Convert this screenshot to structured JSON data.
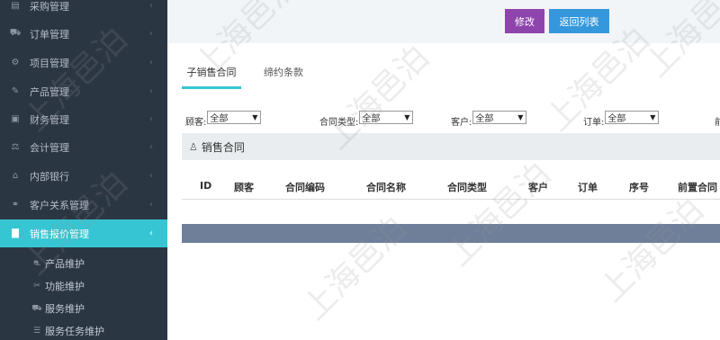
{
  "sidebar": {
    "items": [
      {
        "label": "采购管理",
        "icon": "cart-icon",
        "glyph": "▤"
      },
      {
        "label": "订单管理",
        "icon": "shopping-cart-icon",
        "glyph": "⛟"
      },
      {
        "label": "项目管理",
        "icon": "cogs-icon",
        "glyph": "⚙"
      },
      {
        "label": "产品管理",
        "icon": "edit-icon",
        "glyph": "✎"
      },
      {
        "label": "财务管理",
        "icon": "money-icon",
        "glyph": "▣"
      },
      {
        "label": "会计管理",
        "icon": "balance-scale-icon",
        "glyph": "⚖"
      },
      {
        "label": "内部银行",
        "icon": "bank-icon",
        "glyph": "⌂"
      },
      {
        "label": "客户关系管理",
        "icon": "handshake-icon",
        "glyph": "⚭"
      },
      {
        "label": "销售报价管理",
        "icon": "bar-chart-icon",
        "glyph": "▇"
      }
    ],
    "sub_items": [
      {
        "label": "产品维护",
        "icon": "car-icon",
        "glyph": "⛐"
      },
      {
        "label": "功能维护",
        "icon": "wrench-icon",
        "glyph": "✂"
      },
      {
        "label": "服务维护",
        "icon": "car-alt-icon",
        "glyph": "⛟"
      },
      {
        "label": "服务任务维护",
        "icon": "list-icon",
        "glyph": "☰"
      }
    ],
    "chevron": "‹"
  },
  "toolbar": {
    "edit_label": "修改",
    "back_label": "返回列表"
  },
  "tabs": {
    "active": "子销售合同",
    "other": "缔约条款"
  },
  "filters": {
    "customer_label": "顾客:",
    "customer_value": "全部",
    "contract_type_label": "合同类型:",
    "contract_type_value": "全部",
    "client_label": "客户:",
    "client_value": "全部",
    "order_label": "订单:",
    "order_value": "全部",
    "cut_label": "前"
  },
  "panel": {
    "title": "销售合同",
    "icon": "user-icon"
  },
  "table": {
    "columns": [
      "ID",
      "顾客",
      "合同编码",
      "合同名称",
      "合同类型",
      "客户",
      "订单",
      "序号",
      "前置合同"
    ]
  },
  "watermark": "上海邑泊",
  "colors": {
    "sidebar_bg": "#2b3643",
    "active_bg": "#36c6d3",
    "edit_btn": "#8e44ad",
    "back_btn": "#3598dc",
    "footer_bar": "#6f7f99"
  }
}
